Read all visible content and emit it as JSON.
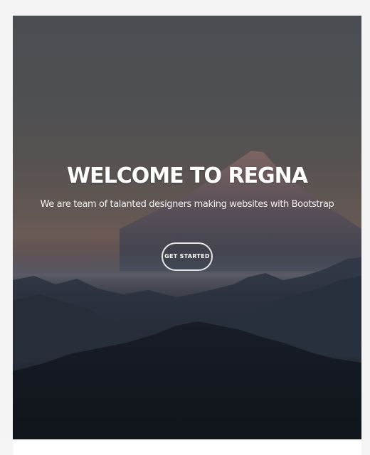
{
  "hero": {
    "title": "WELCOME TO REGNA",
    "subtitle": "We are team of talanted designers making websites with Bootstrap",
    "cta_label": "GET STARTED"
  },
  "colors": {
    "sky_top": "#4a4e52",
    "dusk": "#6b5a55",
    "mountain_dark": "#151a22",
    "text": "#ffffff"
  }
}
